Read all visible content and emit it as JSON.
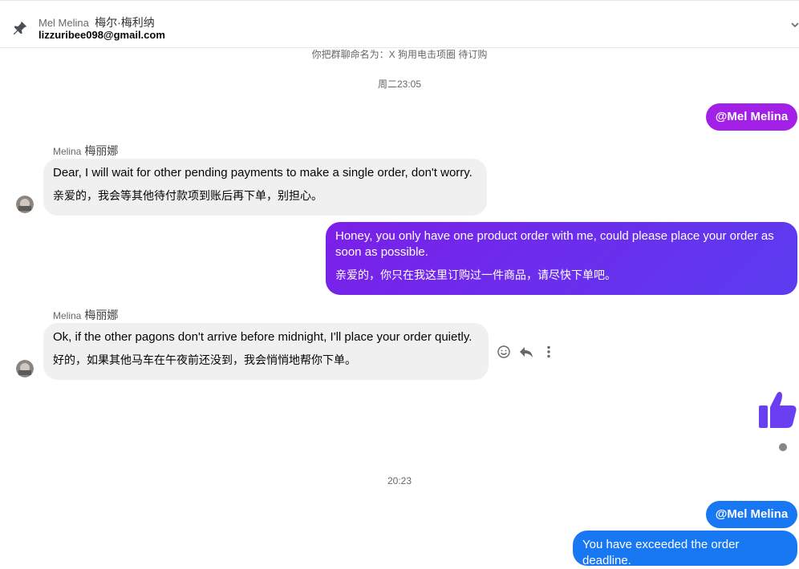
{
  "header": {
    "name": "Mel Melina",
    "name_cn": "梅尔·梅利纳",
    "email": "lizzuribee098@gmail.com"
  },
  "system": {
    "rename_notice": "你把群聊命名为：X 狗用电击项圈 待订购",
    "time1": "周二23:05",
    "time2": "20:23"
  },
  "messages": {
    "mention1": "@Mel Melina",
    "msg1": {
      "sender": "Melina",
      "sender_cn": "梅丽娜",
      "text_en": "Dear, I will wait for other pending payments to make a single order, don't worry.",
      "text_cn": "亲爱的，我会等其他待付款项到账后再下单，别担心。"
    },
    "msg2": {
      "text_en": "Honey, you only have one product order with me, could please place your order as soon as possible.",
      "text_cn": "亲爱的，你只在我这里订购过一件商品，请尽快下单吧。"
    },
    "msg3": {
      "sender": "Melina",
      "sender_cn": "梅丽娜",
      "text_en": "Ok, if the other pagons don't arrive before midnight, I'll place your order quietly.",
      "text_cn": "好的，如果其他马车在午夜前还没到，我会悄悄地帮你下单。"
    },
    "mention2": "@Mel Melina",
    "msg4": {
      "text_en": "You have exceeded the order deadline."
    }
  },
  "icons": {
    "pin": "pin-icon",
    "chevron": "chevron-down-icon",
    "react": "smiley-icon",
    "reply": "reply-icon",
    "more": "more-vertical-icon",
    "like": "thumbs-up-icon"
  },
  "colors": {
    "mention_purple": "#a320e6",
    "outgoing_gradient_start": "#7b1fe8",
    "outgoing_gradient_end": "#5b3cf0",
    "outgoing_blue": "#1877f2",
    "incoming_gray": "#f0f0f0",
    "like_purple": "#6a3ff2"
  }
}
